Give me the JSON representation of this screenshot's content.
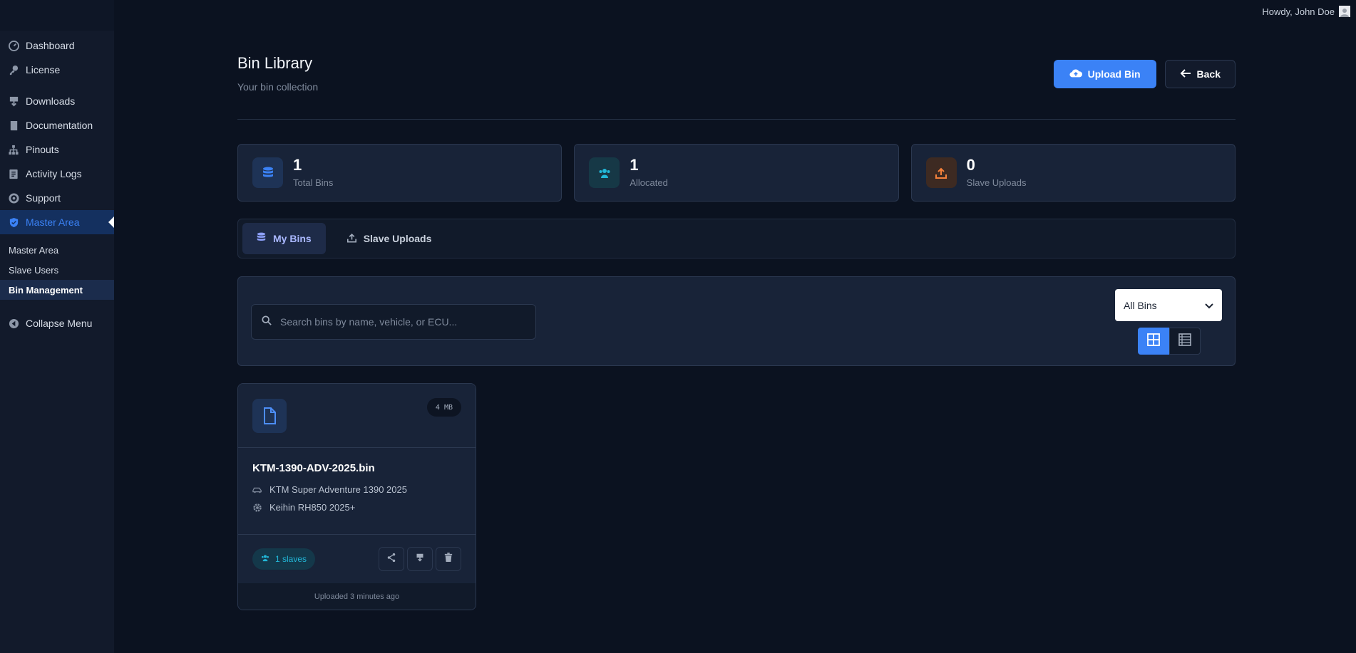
{
  "topbar": {
    "greeting": "Howdy, John Doe"
  },
  "sidebar": {
    "items": [
      {
        "label": "Dashboard",
        "icon": "dashboard-icon"
      },
      {
        "label": "License",
        "icon": "key-icon"
      },
      {
        "label": "Downloads",
        "icon": "download-icon"
      },
      {
        "label": "Documentation",
        "icon": "book-icon"
      },
      {
        "label": "Pinouts",
        "icon": "sitemap-icon"
      },
      {
        "label": "Activity Logs",
        "icon": "list-icon"
      },
      {
        "label": "Support",
        "icon": "support-icon"
      },
      {
        "label": "Master Area",
        "icon": "shield-icon",
        "active": true
      }
    ],
    "sub_items": [
      "Master Area",
      "Slave Users",
      "Bin Management"
    ],
    "collapse_label": "Collapse Menu"
  },
  "header": {
    "title": "Bin Library",
    "subtitle": "Your bin collection",
    "upload_label": "Upload Bin",
    "back_label": "Back"
  },
  "stats": [
    {
      "value": "1",
      "label": "Total Bins",
      "color": "#3b82f6"
    },
    {
      "value": "1",
      "label": "Allocated",
      "color": "#22b8d9"
    },
    {
      "value": "0",
      "label": "Slave Uploads",
      "color": "#f5813b"
    }
  ],
  "tabs": [
    {
      "label": "My Bins",
      "active": true
    },
    {
      "label": "Slave Uploads",
      "active": false
    }
  ],
  "filters": {
    "search_placeholder": "Search bins by name, vehicle, or ECU...",
    "select_value": "All Bins"
  },
  "card": {
    "size": "4 MB",
    "name": "KTM-1390-ADV-2025.bin",
    "vehicle": "KTM Super Adventure 1390 2025",
    "ecu": "Keihin RH850 2025+",
    "slaves": "1 slaves",
    "uploaded": "Uploaded 3 minutes ago"
  },
  "colors": {
    "accent": "#3b82f6",
    "background": "#0b1220"
  }
}
